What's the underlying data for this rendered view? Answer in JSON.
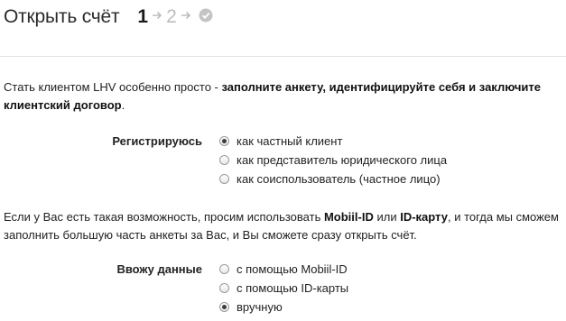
{
  "header": {
    "title": "Открыть счёт",
    "steps": [
      "1",
      "2"
    ],
    "arrow": "→",
    "check_icon": "check-icon"
  },
  "intro": {
    "plain": "Стать клиентом LHV особенно просто - ",
    "bold": "заполните анкету, идентифицируйте себя и заключите клиентский договор",
    "end": "."
  },
  "register": {
    "label": "Регистрируюсь",
    "options": [
      "как частный клиент",
      "как представитель юридического лица",
      "как соиспользователь (частное лицо)"
    ],
    "selected_index": 0
  },
  "para2": {
    "part1": "Если у Вас есть такая возможность, просим использовать ",
    "bold1": "Mobiil-ID",
    "part2": " или ",
    "bold2": "ID-карту",
    "part3": ", и тогда мы сможем заполнить большую часть анкеты за Вас, и Вы сможете сразу открыть счёт."
  },
  "data_entry": {
    "label": "Ввожу данные",
    "options": [
      "с помощью Mobiil-ID",
      "с помощью ID-карты",
      "вручную"
    ],
    "selected_index": 2
  },
  "colors": {
    "text": "#222222",
    "step_inactive": "#bdbdbd",
    "divider": "#e3e3e3"
  }
}
